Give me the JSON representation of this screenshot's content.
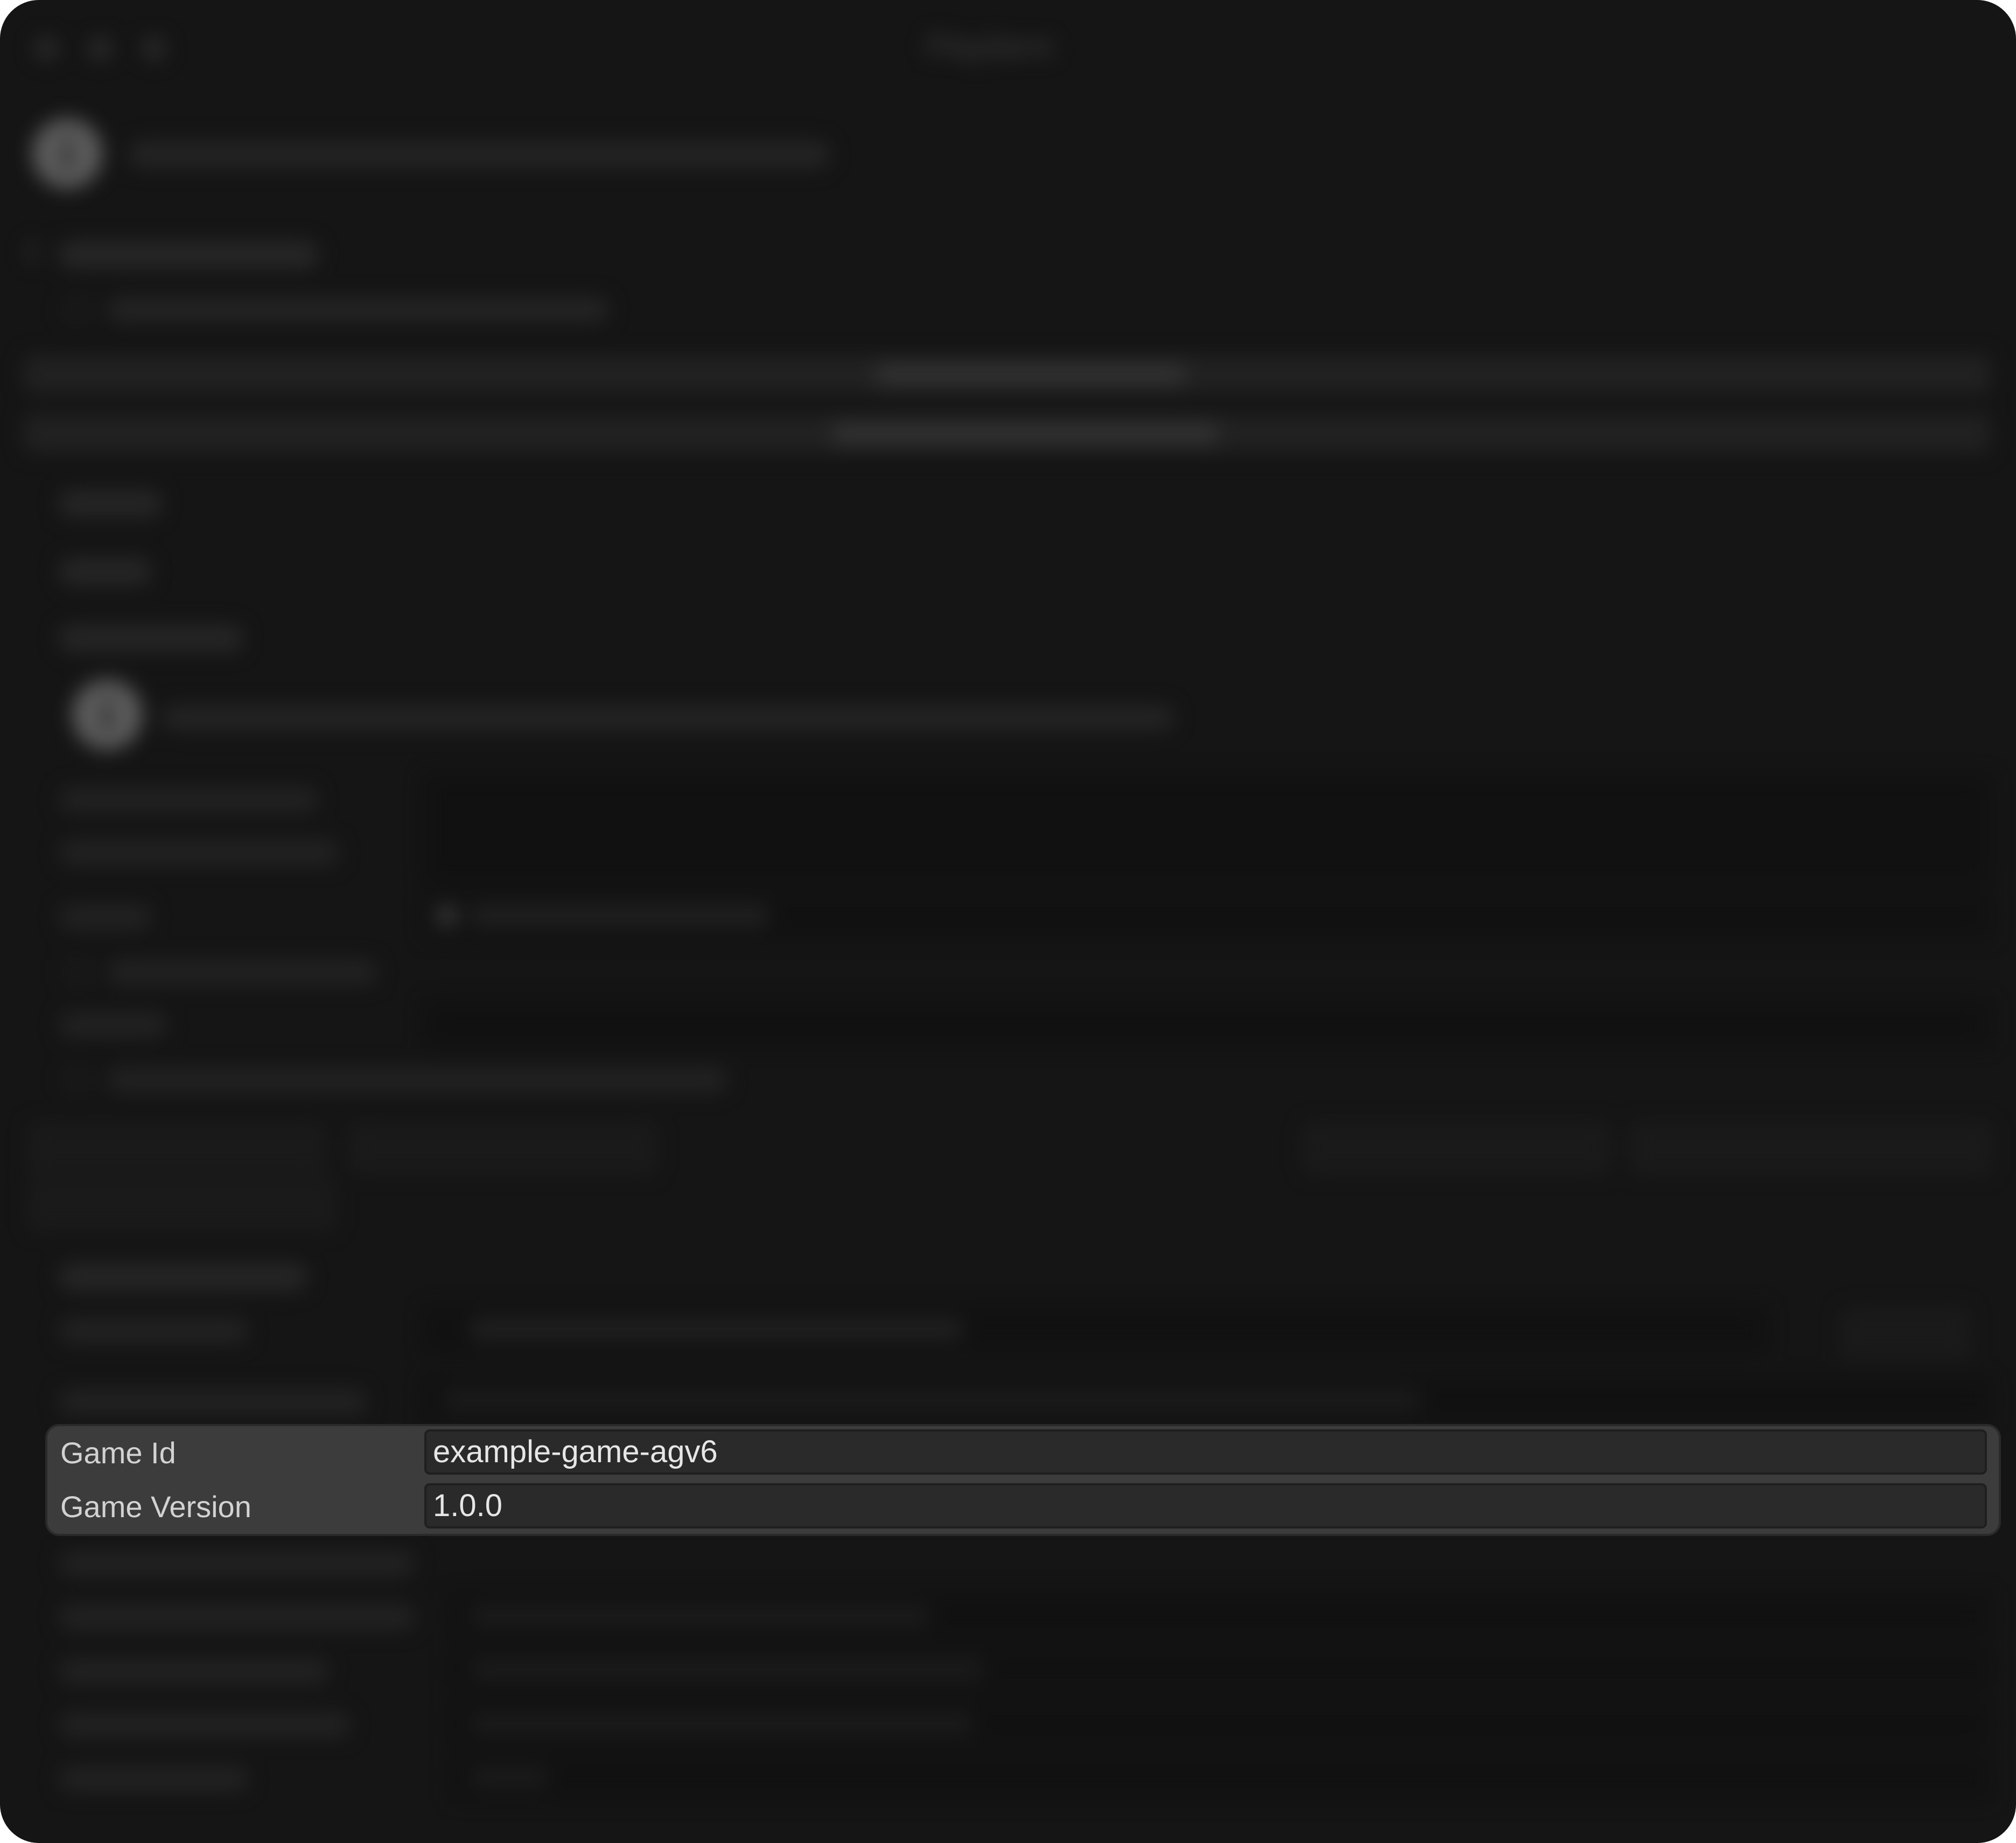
{
  "window": {
    "title": "Playfarm"
  },
  "highlight": {
    "rows": [
      {
        "label": "Game Id",
        "value": "example-game-agv6"
      },
      {
        "label": "Game Version",
        "value": "1.0.0"
      }
    ]
  },
  "colors": {
    "window_bg": "#1c1c1c",
    "panel_bg": "#3c3c3c",
    "input_bg": "#2a2a2a",
    "text": "#e6e6e6"
  }
}
